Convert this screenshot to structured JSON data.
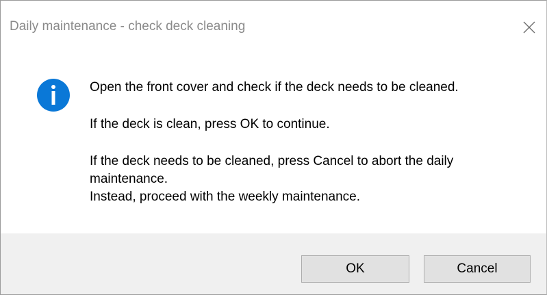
{
  "window": {
    "title": "Daily maintenance - check deck cleaning",
    "close_icon": "close-icon"
  },
  "message": {
    "icon": "info-icon",
    "icon_color": "#0a78d7",
    "line1": "Open the front cover and check if the deck needs to be cleaned.",
    "line2": "If the deck is clean, press OK to continue.",
    "line3": "If the deck needs to be cleaned, press Cancel to abort the daily maintenance.",
    "line4": "Instead, proceed with the weekly maintenance."
  },
  "buttons": {
    "ok_label": "OK",
    "cancel_label": "Cancel"
  }
}
